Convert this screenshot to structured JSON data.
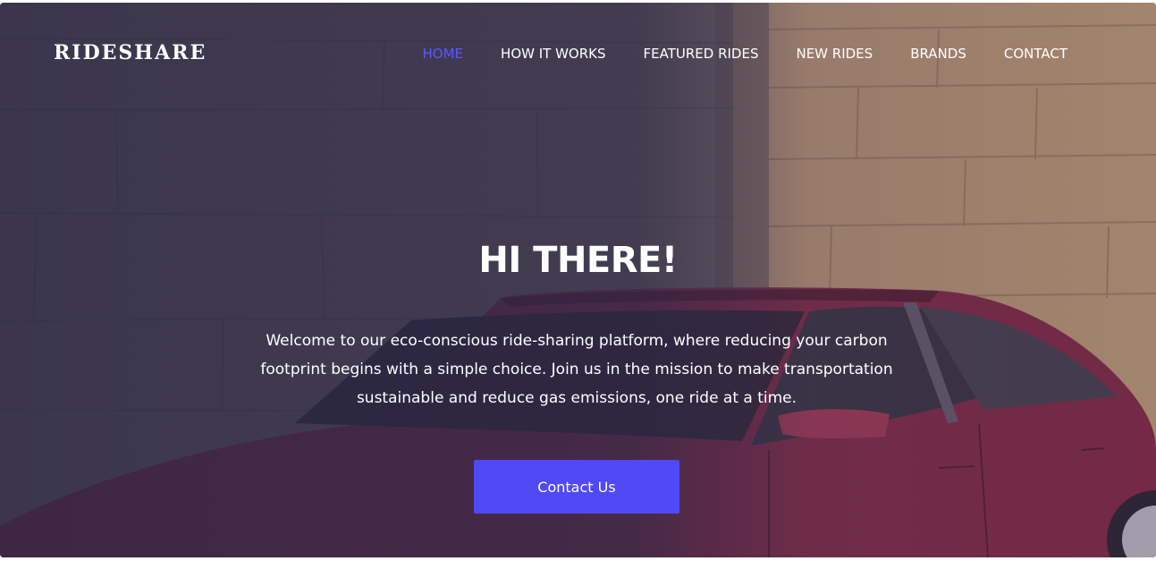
{
  "brand": {
    "name": "RIDESHARE"
  },
  "nav": {
    "items": [
      {
        "label": "HOME",
        "active": true
      },
      {
        "label": "HOW IT WORKS",
        "active": false
      },
      {
        "label": "FEATURED RIDES",
        "active": false
      },
      {
        "label": "NEW RIDES",
        "active": false
      },
      {
        "label": "BRANDS",
        "active": false
      },
      {
        "label": "CONTACT",
        "active": false
      }
    ]
  },
  "hero": {
    "title": "HI THERE!",
    "text": "Welcome to our eco-conscious ride-sharing platform, where reducing your carbon footprint begins with a simple choice. Join us in the mission to make transportation sustainable and reduce gas emissions, one ride at a time.",
    "cta_label": "Contact Us"
  },
  "colors": {
    "accent": "#5049f7",
    "active_nav": "#5b57ff",
    "overlay": "#2c2846",
    "car": "#8a2a45"
  }
}
